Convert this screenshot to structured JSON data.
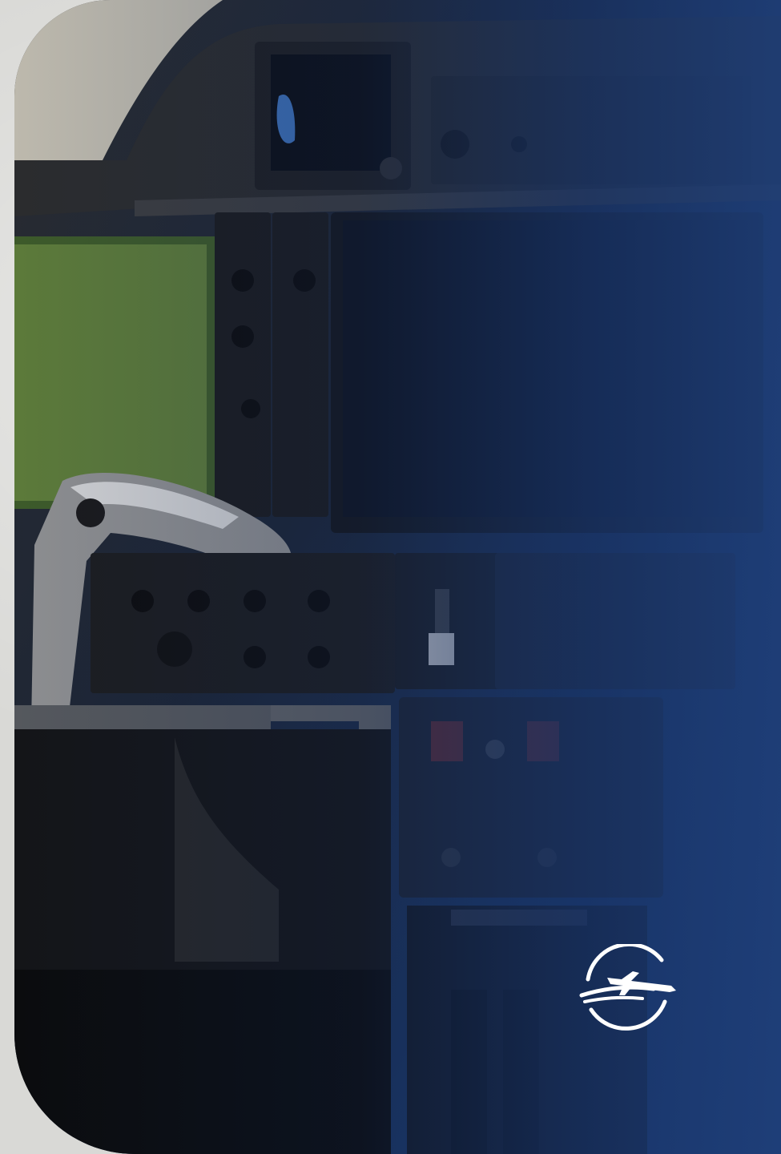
{
  "image": {
    "description_icon": "cockpit-photo",
    "accent_color": "#1f3f78",
    "background_color": "#d9d9d6"
  },
  "logo": {
    "icon": "airplane-logo-icon",
    "color": "#ffffff"
  }
}
